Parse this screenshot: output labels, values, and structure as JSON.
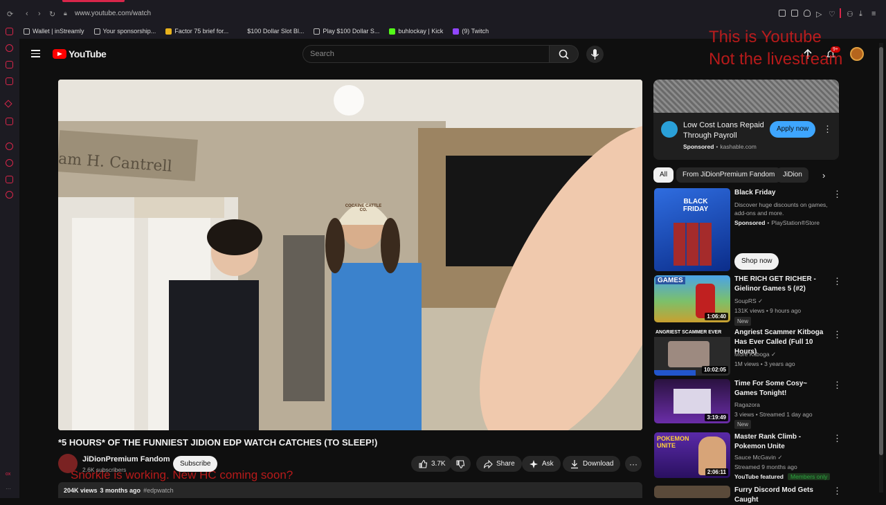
{
  "browser": {
    "url": "www.youtube.com/watch",
    "bookmarks": [
      {
        "label": "Wallet | inStreamly",
        "color": "#888888"
      },
      {
        "label": "Your sponsorship...",
        "color": "#888888"
      },
      {
        "label": "Factor 75 brief for...",
        "color": "#e8b21c"
      },
      {
        "label": "$100 Dollar Slot Bl...",
        "color": "#1c1b22"
      },
      {
        "label": "Play $100 Dollar S...",
        "color": "#888888"
      },
      {
        "label": "buhlockay | Kick",
        "color": "#53fc18"
      },
      {
        "label": "(9) Twitch",
        "color": "#9146ff"
      }
    ]
  },
  "header": {
    "logo_text": "YouTube",
    "search_placeholder": "Search",
    "notif_badge": "9+",
    "overlay_text_line1": "This is Youtube",
    "overlay_text_line2": "Not the livestream"
  },
  "video": {
    "wall_sign": "am H. Cantrell",
    "cap_text": "COCAINE CATTLE CO.",
    "bottom_overlay": "Snorkle is working. New HC coming soon?"
  },
  "meta": {
    "title": "*5 HOURS* OF THE FUNNIEST JIDION EDP WATCH CATCHES (TO SLEEP!)",
    "channel": "JiDionPremium Fandom",
    "subscribers": "2.6K subscribers",
    "subscribe_label": "Subscribe",
    "likes": "3.7K",
    "share_label": "Share",
    "ask_label": "Ask",
    "download_label": "Download",
    "views": "204K views",
    "age": "3 months ago",
    "hashtag": "#edpwatch"
  },
  "ad": {
    "title": "Low Cost Loans Repaid Through Payroll",
    "sponsored": "Sponsored",
    "domain": "kashable.com",
    "cta": "Apply now",
    "logo_text": "kashable"
  },
  "chips": [
    "All",
    "From JiDionPremium Fandom",
    "JiDion"
  ],
  "promo": {
    "title": "Black Friday",
    "desc": "Discover huge discounts on games, add-ons and more.",
    "sponsored": "Sponsored",
    "advertiser": "PlayStation®Store",
    "cta": "Shop now",
    "thumb_text": "BLACK FRIDAY"
  },
  "recommendations": [
    {
      "title": "THE RICH GET RICHER - Gielinor Games 5 (#2)",
      "channel": "SoupRS",
      "stats": "131K views • 9 hours ago",
      "badge": "New",
      "duration": "1:06:40",
      "thumb_label": "GAMES"
    },
    {
      "title": "Angriest Scammer Kitboga Has Ever Called (Full 10 Hours)",
      "channel": "More Kitboga",
      "stats": "1M views • 3 years ago",
      "badge": "",
      "duration": "10:02:05",
      "thumb_label": "ANGRIEST SCAMMER EVER"
    },
    {
      "title": "Time For Some Cosy~ Games Tonight!",
      "channel": "Ragazora",
      "stats": "3 views • Streamed 1 day ago",
      "badge": "New",
      "duration": "3:19:49",
      "thumb_label": ""
    },
    {
      "title": "Master Rank Climb - Pokemon Unite",
      "channel": "Sauce McGavin",
      "stats": "Streamed 9 months ago",
      "badge": "YouTube featured",
      "members": "Members only",
      "duration": "2:06:11",
      "thumb_label": "POKEMON UNITE"
    },
    {
      "title": "Furry Discord Mod Gets Caught",
      "channel": "",
      "stats": "",
      "badge": "",
      "duration": "",
      "thumb_label": ""
    }
  ]
}
